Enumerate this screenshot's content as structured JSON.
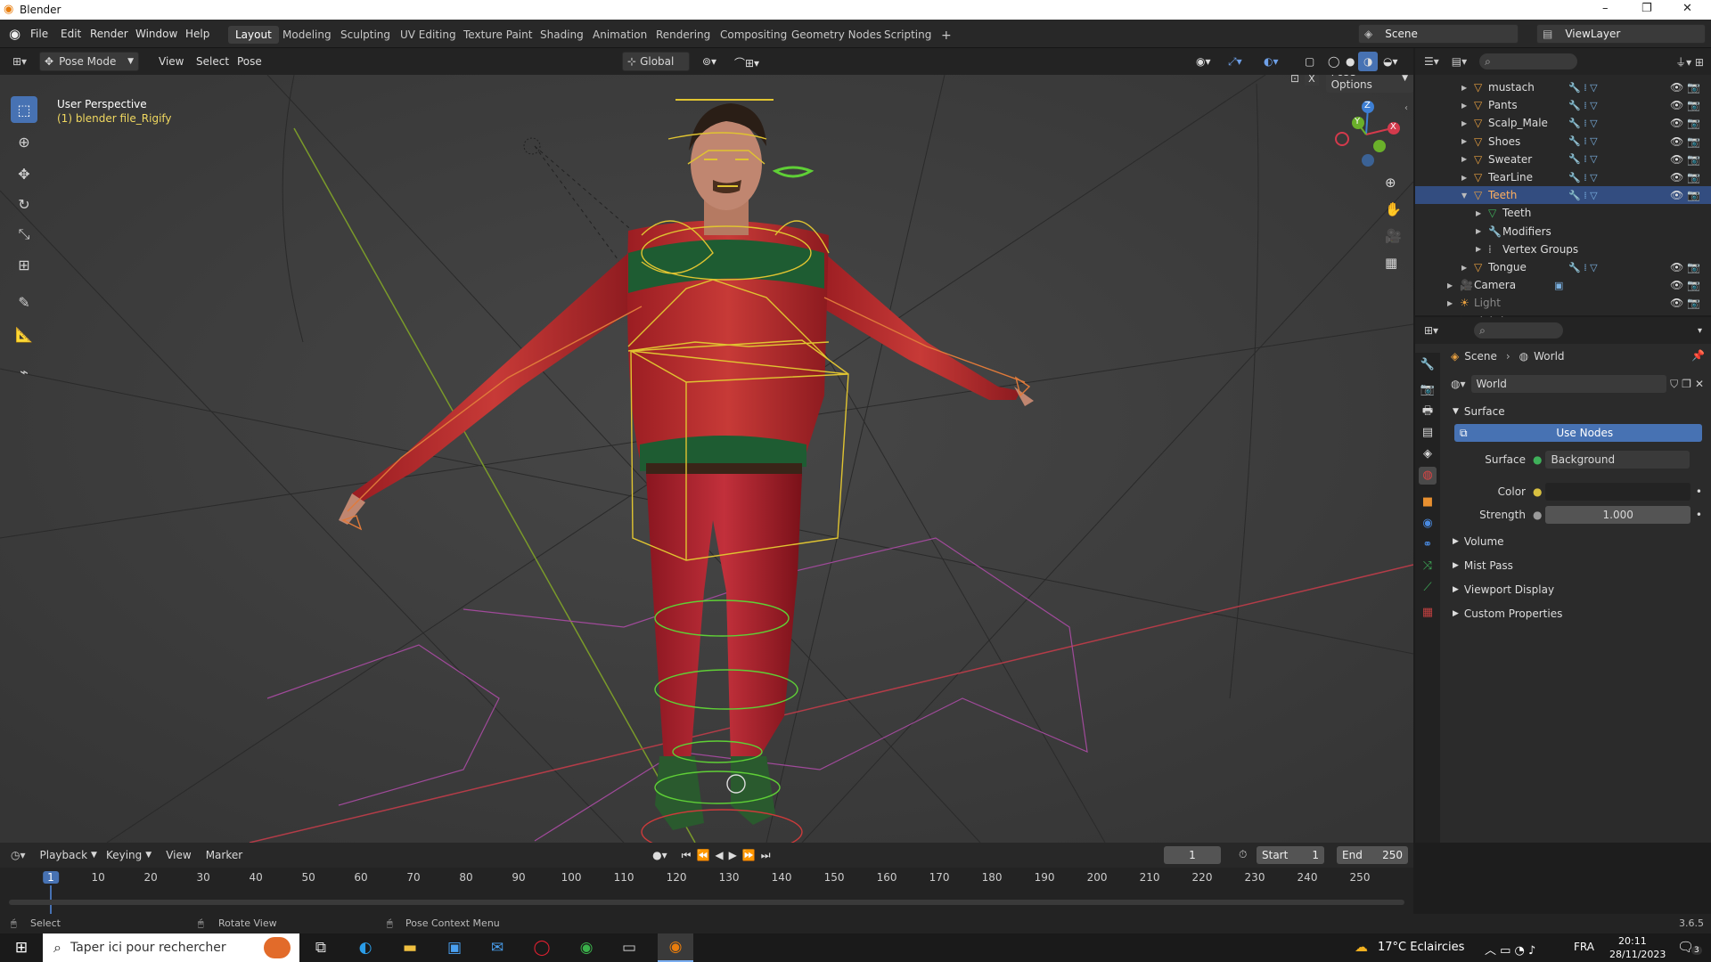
{
  "window": {
    "title": "Blender",
    "minimize": "–",
    "maximize": "❐",
    "close": "✕"
  },
  "menu": [
    "File",
    "Edit",
    "Render",
    "Window",
    "Help"
  ],
  "workspaces": [
    "Layout",
    "Modeling",
    "Sculpting",
    "UV Editing",
    "Texture Paint",
    "Shading",
    "Animation",
    "Rendering",
    "Compositing",
    "Geometry Nodes",
    "Scripting"
  ],
  "add_workspace": "+",
  "scene_name": "Scene",
  "view_layer": "ViewLayer",
  "viewport_header": {
    "mode": "Pose Mode",
    "menus": [
      "View",
      "Select",
      "Pose"
    ],
    "transform": "Global",
    "pose_options": "Pose Options"
  },
  "viewport": {
    "perspective": "User Perspective",
    "object_label": "(1) blender file_Rigify",
    "gizmo_axes": [
      "Z",
      "Y",
      "X"
    ]
  },
  "tools": [
    "select-box",
    "cursor",
    "move",
    "rotate",
    "scale",
    "transform",
    "annotate",
    "measure",
    "pose-relax"
  ],
  "outliner": {
    "rows": [
      {
        "label": "mustach",
        "indent": 1,
        "type": "mesh",
        "expanded": false
      },
      {
        "label": "Pants",
        "indent": 1,
        "type": "mesh",
        "expanded": false
      },
      {
        "label": "Scalp_Male",
        "indent": 1,
        "type": "mesh",
        "expanded": false
      },
      {
        "label": "Shoes",
        "indent": 1,
        "type": "mesh",
        "expanded": false
      },
      {
        "label": "Sweater",
        "indent": 1,
        "type": "mesh",
        "expanded": false
      },
      {
        "label": "TearLine",
        "indent": 1,
        "type": "mesh",
        "expanded": false
      },
      {
        "label": "Teeth",
        "indent": 1,
        "type": "mesh",
        "expanded": true,
        "selected": true
      },
      {
        "label": "Teeth",
        "indent": 2,
        "type": "data",
        "expanded": false
      },
      {
        "label": "Modifiers",
        "indent": 2,
        "type": "modifier",
        "expanded": false
      },
      {
        "label": "Vertex Groups",
        "indent": 2,
        "type": "vgroup",
        "expanded": false
      },
      {
        "label": "Tongue",
        "indent": 1,
        "type": "mesh",
        "expanded": false
      },
      {
        "label": "Camera",
        "indent": 0,
        "type": "camera",
        "expanded": false
      },
      {
        "label": "Light",
        "indent": 0,
        "type": "light",
        "expanded": false
      },
      {
        "label": "Lighting",
        "indent": 0,
        "type": "collection",
        "expanded": true
      }
    ]
  },
  "properties": {
    "breadcrumb": [
      "Scene",
      "World"
    ],
    "world_name": "World",
    "surface_panel": "Surface",
    "use_nodes": "Use Nodes",
    "surface_label": "Surface",
    "surface_value": "Background",
    "color_label": "Color",
    "strength_label": "Strength",
    "strength_value": "1.000",
    "collapsed_panels": [
      "Volume",
      "Mist Pass",
      "Viewport Display",
      "Custom Properties"
    ]
  },
  "timeline": {
    "menus": [
      "Playback",
      "Keying",
      "View",
      "Marker"
    ],
    "current_frame": "1",
    "start_label": "Start",
    "start_value": "1",
    "end_label": "End",
    "end_value": "250",
    "ticks": [
      "1",
      "10",
      "20",
      "30",
      "40",
      "50",
      "60",
      "70",
      "80",
      "90",
      "100",
      "110",
      "120",
      "130",
      "140",
      "150",
      "160",
      "170",
      "180",
      "190",
      "200",
      "210",
      "220",
      "230",
      "240",
      "250"
    ]
  },
  "statusbar": {
    "select": "Select",
    "rotate": "Rotate View",
    "context": "Pose Context Menu",
    "version": "3.6.5"
  },
  "taskbar": {
    "search_placeholder": "Taper ici pour rechercher",
    "weather": "17°C  Eclaircies",
    "language": "FRA",
    "time": "20:11",
    "date": "28/11/2023",
    "notifications": "3"
  },
  "colors": {
    "accent": "#4772b3",
    "selected_row": "#334d80",
    "header": "#232323",
    "viewport_bg": "#3c3c3c",
    "bone_yellow": "#e0c431",
    "bone_green": "#5fcf36",
    "x_axis": "#d43a4c",
    "y_axis": "#6ab02a",
    "z_axis": "#3d7fd4"
  }
}
